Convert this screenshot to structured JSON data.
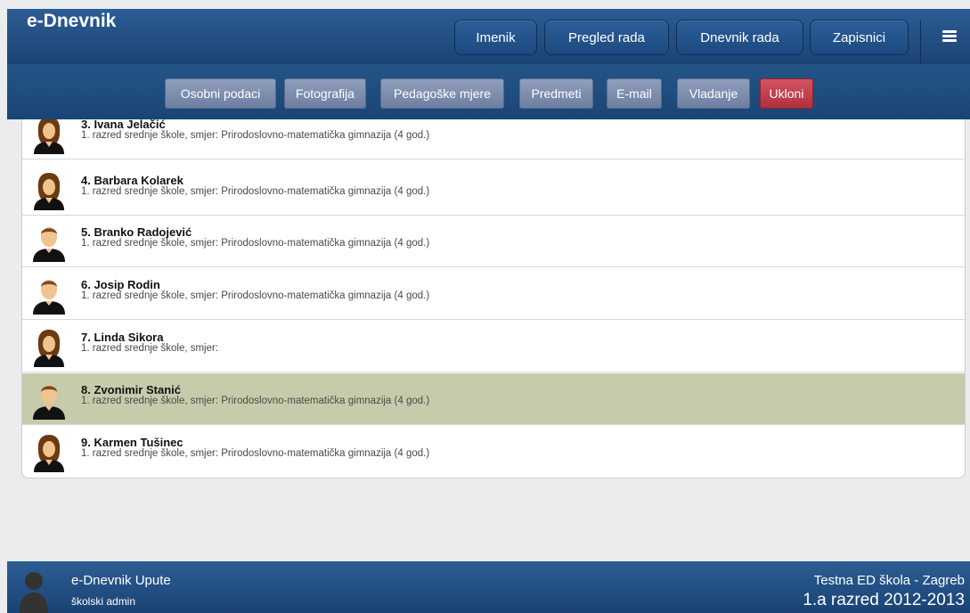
{
  "header": {
    "brand": "e-Dnevnik",
    "nav": [
      "Imenik",
      "Pregled rada",
      "Dnevnik rada",
      "Zapisnici"
    ]
  },
  "toolbar": {
    "buttons": [
      "Osobni podaci",
      "Fotografija",
      "Pedagoške mjere",
      "Predmeti",
      "E-mail",
      "Vladanje"
    ],
    "remove": "Ukloni"
  },
  "students": [
    {
      "name": "3. Ivana Jelačić",
      "detail": "1. razred srednje škole, smjer: Prirodoslovno-matematička gimnazija (4 god.)",
      "gender": "female"
    },
    {
      "name": "4. Barbara Kolarek",
      "detail": "1. razred srednje škole, smjer: Prirodoslovno-matematička gimnazija (4 god.)",
      "gender": "female"
    },
    {
      "name": "5. Branko Radojević",
      "detail": "1. razred srednje škole, smjer: Prirodoslovno-matematička gimnazija (4 god.)",
      "gender": "male"
    },
    {
      "name": "6. Josip Rodin",
      "detail": "1. razred srednje škole, smjer: Prirodoslovno-matematička gimnazija (4 god.)",
      "gender": "male"
    },
    {
      "name": "7. Linda Sikora",
      "detail": "1. razred srednje škole, smjer:",
      "gender": "female"
    },
    {
      "name": "8. Zvonimir Stanić",
      "detail": "1. razred srednje škole, smjer: Prirodoslovno-matematička gimnazija (4 god.)",
      "gender": "male",
      "selected": true
    },
    {
      "name": "9. Karmen Tušinec",
      "detail": "1. razred srednje škole, smjer: Prirodoslovno-matematička gimnazija (4 god.)",
      "gender": "female"
    }
  ],
  "footer": {
    "title": "e-Dnevnik Upute",
    "role": "školski admin",
    "school": "Testna ED škola - Zagreb",
    "class": "1.a razred 2012-2013"
  },
  "colors": {
    "header": "#1f4a7c",
    "selected_row": "#c6ccab",
    "danger": "#c0394a"
  }
}
